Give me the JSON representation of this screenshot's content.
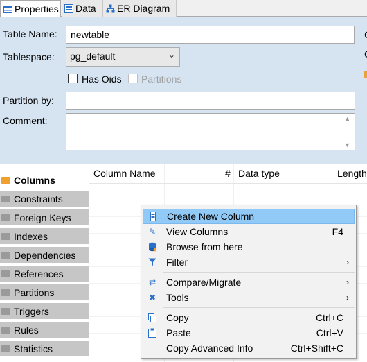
{
  "tabs": [
    {
      "label": "Properties",
      "icon": "table-icon"
    },
    {
      "label": "Data",
      "icon": "data-icon"
    },
    {
      "label": "ER Diagram",
      "icon": "er-diagram-icon"
    }
  ],
  "form": {
    "table_name_label": "Table Name:",
    "table_name_value": "newtable",
    "tablespace_label": "Tablespace:",
    "tablespace_value": "pg_default",
    "has_oids_label": "Has Oids",
    "partitions_label": "Partitions",
    "partition_by_label": "Partition by:",
    "partition_by_value": "",
    "comment_label": "Comment:",
    "comment_value": "",
    "clipped_right": [
      "C",
      "C"
    ]
  },
  "sidebar": {
    "items": [
      {
        "label": "Columns",
        "active": true
      },
      {
        "label": "Constraints"
      },
      {
        "label": "Foreign Keys"
      },
      {
        "label": "Indexes"
      },
      {
        "label": "Dependencies"
      },
      {
        "label": "References"
      },
      {
        "label": "Partitions"
      },
      {
        "label": "Triggers"
      },
      {
        "label": "Rules"
      },
      {
        "label": "Statistics"
      }
    ]
  },
  "grid": {
    "columns": [
      "Column Name",
      "#",
      "Data type",
      "Length"
    ]
  },
  "context_menu": {
    "items": [
      {
        "label": "Create New Column",
        "icon": "column-icon",
        "shortcut": "",
        "highlighted": true
      },
      {
        "label": "View Columns",
        "icon": "pencil-icon",
        "shortcut": "F4"
      },
      {
        "label": "Browse from here",
        "icon": "database-icon",
        "shortcut": ""
      },
      {
        "label": "Filter",
        "icon": "filter-icon",
        "shortcut": "",
        "submenu": true
      },
      {
        "label": "Compare/Migrate",
        "icon": "compare-icon",
        "shortcut": "",
        "submenu": true
      },
      {
        "label": "Tools",
        "icon": "tools-icon",
        "shortcut": "",
        "submenu": true
      },
      {
        "label": "Copy",
        "icon": "copy-icon",
        "shortcut": "Ctrl+C"
      },
      {
        "label": "Paste",
        "icon": "paste-icon",
        "shortcut": "Ctrl+V"
      },
      {
        "label": "Copy Advanced Info",
        "icon": "",
        "shortcut": "Ctrl+Shift+C"
      }
    ]
  },
  "colors": {
    "panel_bg": "#d6e4f2",
    "menu_highlight": "#91c9f7",
    "sidebar_tab": "#c6c6c6",
    "icon_accent": "#f0a030"
  }
}
